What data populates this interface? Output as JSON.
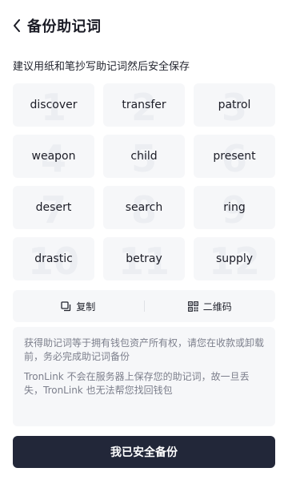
{
  "header": {
    "title": "备份助记词"
  },
  "subtitle": "建议用纸和笔抄写助记词然后安全保存",
  "words": [
    {
      "num": "1",
      "word": "discover"
    },
    {
      "num": "2",
      "word": "transfer"
    },
    {
      "num": "3",
      "word": "patrol"
    },
    {
      "num": "4",
      "word": "weapon"
    },
    {
      "num": "5",
      "word": "child"
    },
    {
      "num": "6",
      "word": "present"
    },
    {
      "num": "7",
      "word": "desert"
    },
    {
      "num": "8",
      "word": "search"
    },
    {
      "num": "9",
      "word": "ring"
    },
    {
      "num": "10",
      "word": "drastic"
    },
    {
      "num": "11",
      "word": "betray"
    },
    {
      "num": "12",
      "word": "supply"
    }
  ],
  "actions": {
    "copy": "复制",
    "qrcode": "二维码"
  },
  "notice": {
    "p1": "获得助记词等于拥有钱包资产所有权，请您在收款或卸载前，务必完成助记词备份",
    "p2": "TronLink 不会在服务器上保存您的助记词，故一旦丢失，TronLink 也无法帮您找回钱包"
  },
  "confirm_label": "我已安全备份"
}
